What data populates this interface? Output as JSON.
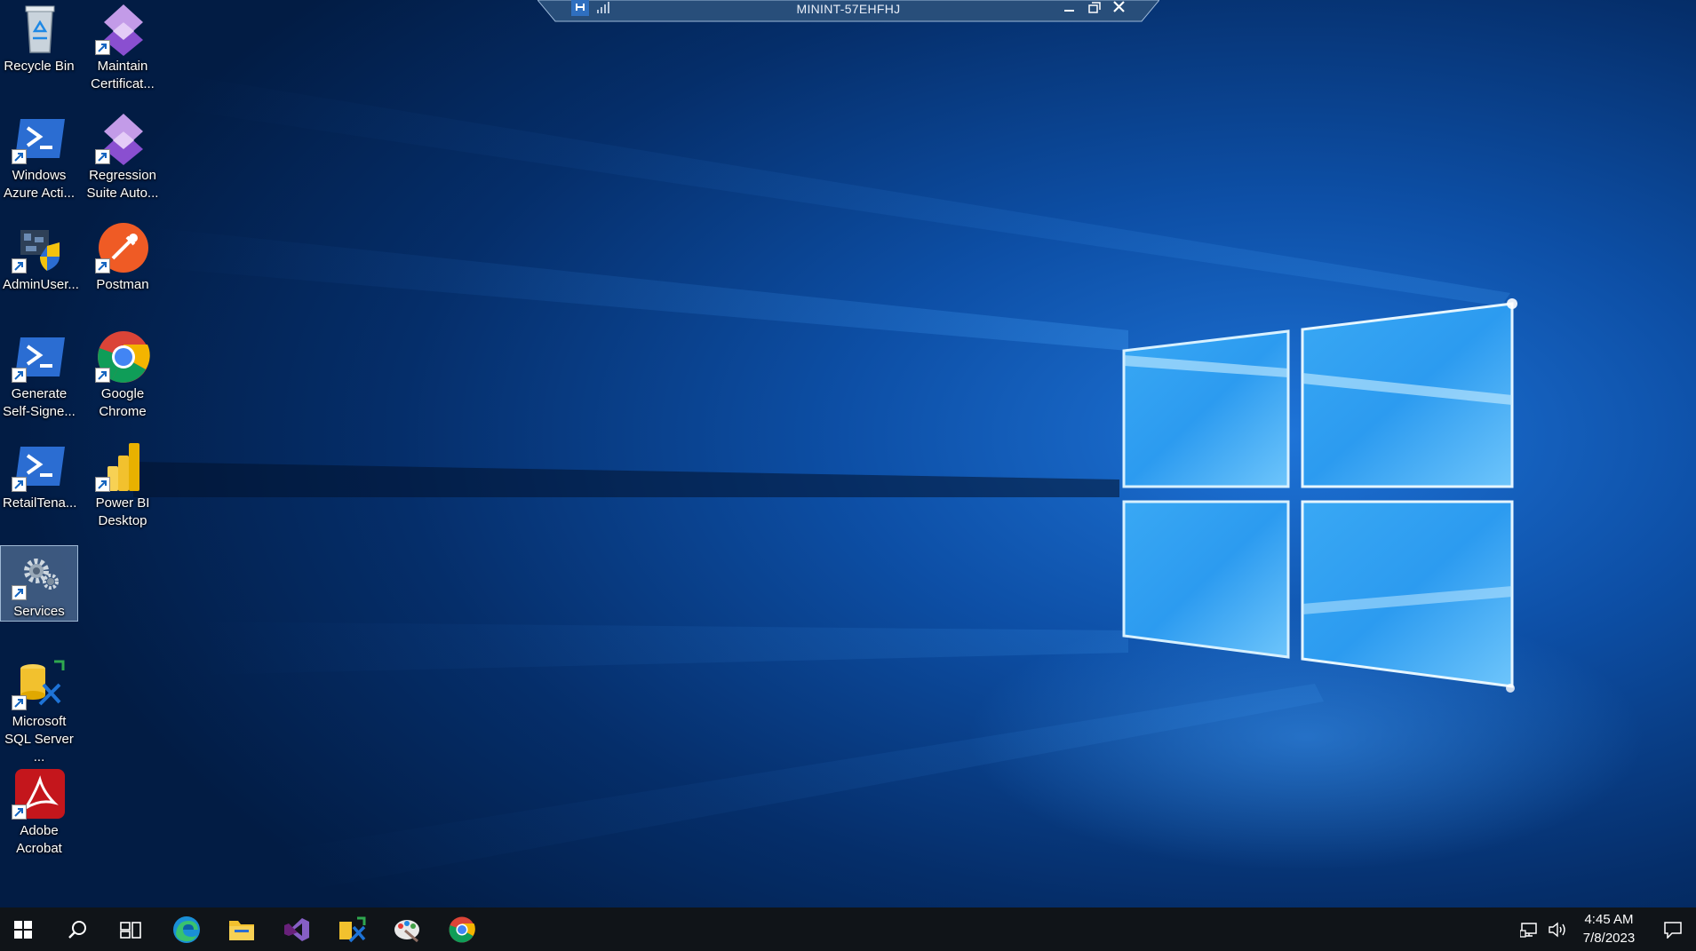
{
  "rdp": {
    "title": "MININT-57EHFHJ"
  },
  "desktop": {
    "icons": [
      {
        "id": "recycle-bin",
        "label": "Recycle Bin"
      },
      {
        "id": "maintain-certificates",
        "label": "Maintain\nCertificat..."
      },
      {
        "id": "windows-azure-active",
        "label": "Windows\nAzure Acti..."
      },
      {
        "id": "regression-suite",
        "label": "Regression\nSuite Auto..."
      },
      {
        "id": "adminuser",
        "label": "AdminUser..."
      },
      {
        "id": "postman",
        "label": "Postman"
      },
      {
        "id": "generate-self-signed",
        "label": "Generate\nSelf-Signe..."
      },
      {
        "id": "google-chrome",
        "label": "Google\nChrome"
      },
      {
        "id": "retailtenant",
        "label": "RetailTena..."
      },
      {
        "id": "power-bi-desktop",
        "label": "Power BI\nDesktop"
      },
      {
        "id": "services",
        "label": "Services",
        "selected": true
      },
      {
        "id": "sql-server",
        "label": "Microsoft\nSQL Server ..."
      },
      {
        "id": "adobe-acrobat",
        "label": "Adobe\nAcrobat"
      }
    ]
  },
  "taskbar": {
    "pinned": [
      "start-icon",
      "search-icon",
      "task-view-icon",
      "edge-icon",
      "file-explorer-icon",
      "visual-studio-icon",
      "sql-config-icon",
      "paint-icon",
      "chrome-icon"
    ],
    "tray": {
      "time": "4:45 AM",
      "date": "7/8/2023"
    }
  },
  "colors": {
    "taskbar": "#101418",
    "accent": "#1e90ff",
    "wallpaper_dark": "#03214a"
  }
}
